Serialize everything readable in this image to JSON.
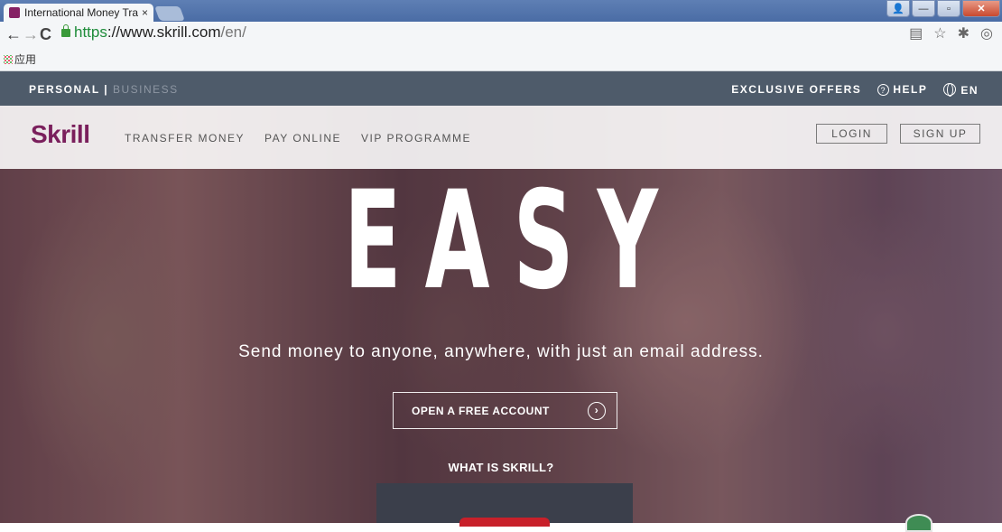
{
  "browser": {
    "tab_title": "International Money Tra",
    "tab_close": "×",
    "url_scheme": "https",
    "url_host": "://www.skrill.com",
    "url_path": "/en/",
    "bookmarks_label": "应用",
    "nav": {
      "back": "←",
      "forward": "→",
      "reload": "C"
    },
    "tb_icons": [
      "translate-icon",
      "star-icon",
      "extension-icon",
      "shield-icon"
    ]
  },
  "topbar": {
    "personal": "PERSONAL |",
    "business": " BUSINESS",
    "offers": "EXCLUSIVE OFFERS",
    "help": "HELP",
    "help_icon": "?",
    "lang": "EN"
  },
  "mainnav": {
    "logo": "Skrill",
    "links": [
      "TRANSFER MONEY",
      "PAY ONLINE",
      "VIP PROGRAMME"
    ],
    "login": "LOGIN",
    "signup": "SIGN UP"
  },
  "hero": {
    "headline": "EASY",
    "tagline": "Send money to anyone, anywhere, with just an email address.",
    "cta": "OPEN A FREE ACCOUNT",
    "cta_icon": "›",
    "whatis": "WHAT IS SKRILL?"
  },
  "colors": {
    "brand": "#862165",
    "topbar_bg": "#4e5b6a"
  }
}
